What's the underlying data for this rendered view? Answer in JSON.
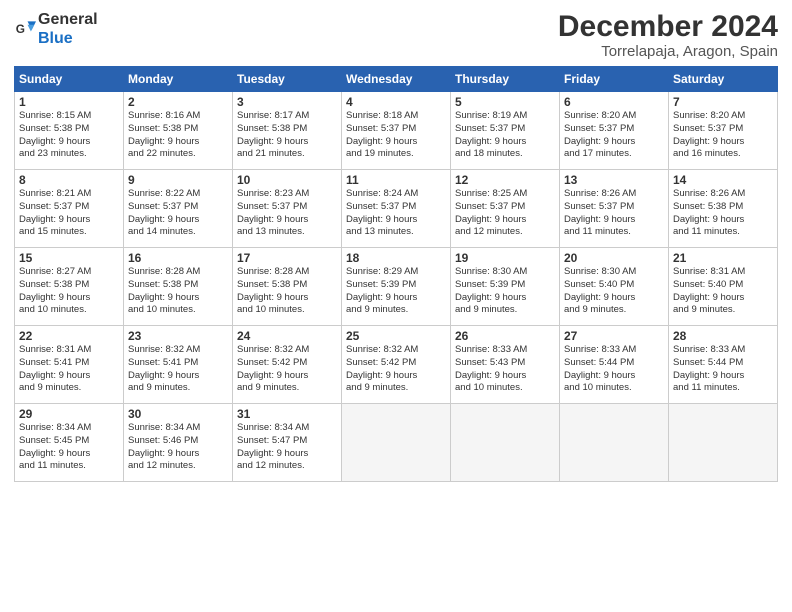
{
  "logo": {
    "line1": "General",
    "line2": "Blue"
  },
  "title": "December 2024",
  "location": "Torrelapaja, Aragon, Spain",
  "headers": [
    "Sunday",
    "Monday",
    "Tuesday",
    "Wednesday",
    "Thursday",
    "Friday",
    "Saturday"
  ],
  "weeks": [
    [
      {
        "day": "1",
        "lines": [
          "Sunrise: 8:15 AM",
          "Sunset: 5:38 PM",
          "Daylight: 9 hours",
          "and 23 minutes."
        ]
      },
      {
        "day": "2",
        "lines": [
          "Sunrise: 8:16 AM",
          "Sunset: 5:38 PM",
          "Daylight: 9 hours",
          "and 22 minutes."
        ]
      },
      {
        "day": "3",
        "lines": [
          "Sunrise: 8:17 AM",
          "Sunset: 5:38 PM",
          "Daylight: 9 hours",
          "and 21 minutes."
        ]
      },
      {
        "day": "4",
        "lines": [
          "Sunrise: 8:18 AM",
          "Sunset: 5:37 PM",
          "Daylight: 9 hours",
          "and 19 minutes."
        ]
      },
      {
        "day": "5",
        "lines": [
          "Sunrise: 8:19 AM",
          "Sunset: 5:37 PM",
          "Daylight: 9 hours",
          "and 18 minutes."
        ]
      },
      {
        "day": "6",
        "lines": [
          "Sunrise: 8:20 AM",
          "Sunset: 5:37 PM",
          "Daylight: 9 hours",
          "and 17 minutes."
        ]
      },
      {
        "day": "7",
        "lines": [
          "Sunrise: 8:20 AM",
          "Sunset: 5:37 PM",
          "Daylight: 9 hours",
          "and 16 minutes."
        ]
      }
    ],
    [
      {
        "day": "8",
        "lines": [
          "Sunrise: 8:21 AM",
          "Sunset: 5:37 PM",
          "Daylight: 9 hours",
          "and 15 minutes."
        ]
      },
      {
        "day": "9",
        "lines": [
          "Sunrise: 8:22 AM",
          "Sunset: 5:37 PM",
          "Daylight: 9 hours",
          "and 14 minutes."
        ]
      },
      {
        "day": "10",
        "lines": [
          "Sunrise: 8:23 AM",
          "Sunset: 5:37 PM",
          "Daylight: 9 hours",
          "and 13 minutes."
        ]
      },
      {
        "day": "11",
        "lines": [
          "Sunrise: 8:24 AM",
          "Sunset: 5:37 PM",
          "Daylight: 9 hours",
          "and 13 minutes."
        ]
      },
      {
        "day": "12",
        "lines": [
          "Sunrise: 8:25 AM",
          "Sunset: 5:37 PM",
          "Daylight: 9 hours",
          "and 12 minutes."
        ]
      },
      {
        "day": "13",
        "lines": [
          "Sunrise: 8:26 AM",
          "Sunset: 5:37 PM",
          "Daylight: 9 hours",
          "and 11 minutes."
        ]
      },
      {
        "day": "14",
        "lines": [
          "Sunrise: 8:26 AM",
          "Sunset: 5:38 PM",
          "Daylight: 9 hours",
          "and 11 minutes."
        ]
      }
    ],
    [
      {
        "day": "15",
        "lines": [
          "Sunrise: 8:27 AM",
          "Sunset: 5:38 PM",
          "Daylight: 9 hours",
          "and 10 minutes."
        ]
      },
      {
        "day": "16",
        "lines": [
          "Sunrise: 8:28 AM",
          "Sunset: 5:38 PM",
          "Daylight: 9 hours",
          "and 10 minutes."
        ]
      },
      {
        "day": "17",
        "lines": [
          "Sunrise: 8:28 AM",
          "Sunset: 5:38 PM",
          "Daylight: 9 hours",
          "and 10 minutes."
        ]
      },
      {
        "day": "18",
        "lines": [
          "Sunrise: 8:29 AM",
          "Sunset: 5:39 PM",
          "Daylight: 9 hours",
          "and 9 minutes."
        ]
      },
      {
        "day": "19",
        "lines": [
          "Sunrise: 8:30 AM",
          "Sunset: 5:39 PM",
          "Daylight: 9 hours",
          "and 9 minutes."
        ]
      },
      {
        "day": "20",
        "lines": [
          "Sunrise: 8:30 AM",
          "Sunset: 5:40 PM",
          "Daylight: 9 hours",
          "and 9 minutes."
        ]
      },
      {
        "day": "21",
        "lines": [
          "Sunrise: 8:31 AM",
          "Sunset: 5:40 PM",
          "Daylight: 9 hours",
          "and 9 minutes."
        ]
      }
    ],
    [
      {
        "day": "22",
        "lines": [
          "Sunrise: 8:31 AM",
          "Sunset: 5:41 PM",
          "Daylight: 9 hours",
          "and 9 minutes."
        ]
      },
      {
        "day": "23",
        "lines": [
          "Sunrise: 8:32 AM",
          "Sunset: 5:41 PM",
          "Daylight: 9 hours",
          "and 9 minutes."
        ]
      },
      {
        "day": "24",
        "lines": [
          "Sunrise: 8:32 AM",
          "Sunset: 5:42 PM",
          "Daylight: 9 hours",
          "and 9 minutes."
        ]
      },
      {
        "day": "25",
        "lines": [
          "Sunrise: 8:32 AM",
          "Sunset: 5:42 PM",
          "Daylight: 9 hours",
          "and 9 minutes."
        ]
      },
      {
        "day": "26",
        "lines": [
          "Sunrise: 8:33 AM",
          "Sunset: 5:43 PM",
          "Daylight: 9 hours",
          "and 10 minutes."
        ]
      },
      {
        "day": "27",
        "lines": [
          "Sunrise: 8:33 AM",
          "Sunset: 5:44 PM",
          "Daylight: 9 hours",
          "and 10 minutes."
        ]
      },
      {
        "day": "28",
        "lines": [
          "Sunrise: 8:33 AM",
          "Sunset: 5:44 PM",
          "Daylight: 9 hours",
          "and 11 minutes."
        ]
      }
    ],
    [
      {
        "day": "29",
        "lines": [
          "Sunrise: 8:34 AM",
          "Sunset: 5:45 PM",
          "Daylight: 9 hours",
          "and 11 minutes."
        ]
      },
      {
        "day": "30",
        "lines": [
          "Sunrise: 8:34 AM",
          "Sunset: 5:46 PM",
          "Daylight: 9 hours",
          "and 12 minutes."
        ]
      },
      {
        "day": "31",
        "lines": [
          "Sunrise: 8:34 AM",
          "Sunset: 5:47 PM",
          "Daylight: 9 hours",
          "and 12 minutes."
        ]
      },
      null,
      null,
      null,
      null
    ]
  ]
}
